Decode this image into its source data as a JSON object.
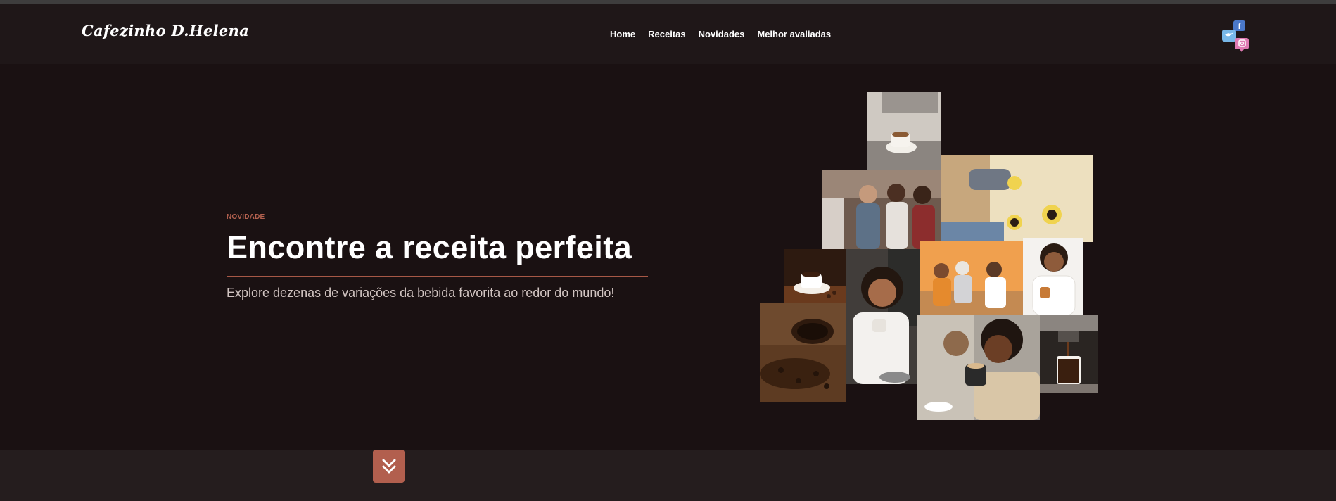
{
  "header": {
    "logo": "Cafezinho D.Helena",
    "nav": [
      "Home",
      "Receitas",
      "Novidades",
      "Melhor avaliadas"
    ]
  },
  "hero": {
    "eyebrow": "NOVIDADE",
    "title": "Encontre a receita perfeita",
    "subtitle": "Explore dezenas de variações da bebida favorita ao redor do mundo!"
  },
  "icons": {
    "social": [
      "facebook-icon",
      "twitter-icon",
      "instagram-icon"
    ],
    "scroll": "double-chevron-down-icon"
  },
  "colors": {
    "background": "#1a1112",
    "header": "#1f1718",
    "accent": "#b25f4e",
    "footer": "#251d1e"
  }
}
